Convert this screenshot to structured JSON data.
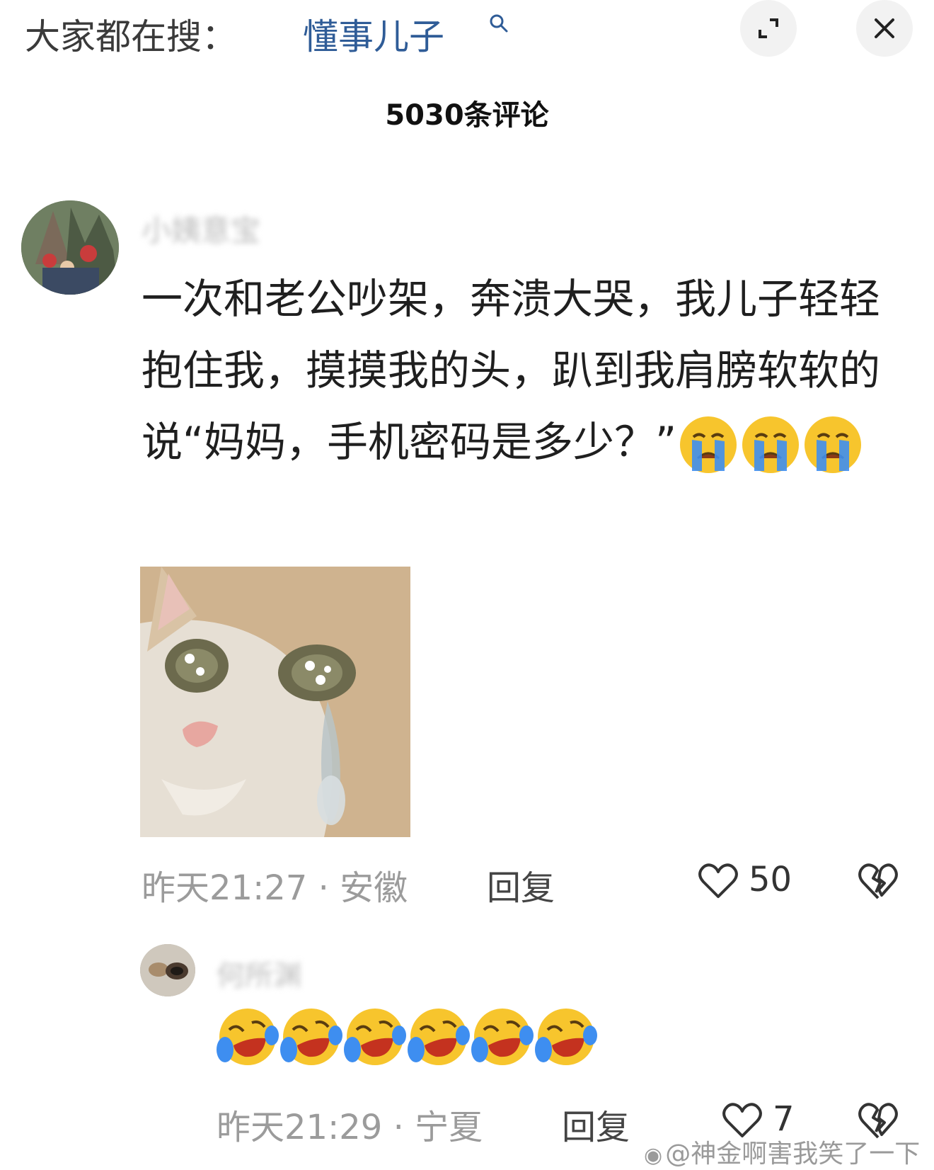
{
  "search_bar": {
    "prefix": "大家都在搜：",
    "term": "懂事儿子"
  },
  "comments_header": {
    "count_label": "5030条评论"
  },
  "comments": [
    {
      "username": "小姨意宝",
      "text": "一次和老公吵架，奔溃大哭，我儿子轻轻抱住我，摸摸我的头，趴到我肩膀软软的说“妈妈，手机密码是多少？”",
      "trailing_emojis": [
        "loudly-crying-face",
        "loudly-crying-face",
        "loudly-crying-face"
      ],
      "image": "crying-cat-meme",
      "meta": "昨天21:27 · 安徽",
      "reply_label": "回复",
      "like_count": "50"
    },
    {
      "username": "何所渊",
      "emojis": [
        "laughing-crying-face",
        "laughing-crying-face",
        "laughing-crying-face",
        "laughing-crying-face",
        "laughing-crying-face",
        "laughing-crying-face"
      ],
      "meta": "昨天21:29 · 宁夏",
      "reply_label": "回复",
      "like_count": "7"
    }
  ],
  "watermark": {
    "text": "@神金啊害我笑了一下"
  },
  "colors": {
    "search_term": "#2f5c97",
    "meta_text": "#9b9b9b",
    "emoji_yellow": "#f7c52d",
    "emoji_tear_blue": "#3e8ef0"
  }
}
